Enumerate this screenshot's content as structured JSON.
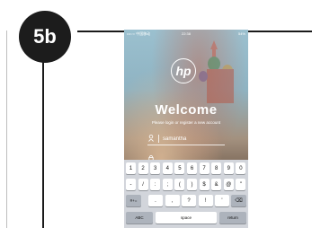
{
  "figure": {
    "label": "5b"
  },
  "status_bar": {
    "carrier": "•••○○ 中国移动",
    "wifi": "⌒",
    "time": "22:38",
    "battery": "54%"
  },
  "app": {
    "logo_text": "hp",
    "welcome": "Welcome",
    "subtitle": "Please login or register a new account",
    "username_value": "samantha",
    "user_icon": "user-icon",
    "lock_icon": "lock-icon"
  },
  "keyboard": {
    "row1": [
      "1",
      "2",
      "3",
      "4",
      "5",
      "6",
      "7",
      "8",
      "9",
      "0"
    ],
    "row2": [
      "-",
      "/",
      ":",
      ";",
      "(",
      ")",
      "$",
      "&",
      "@",
      "\""
    ],
    "row3": {
      "mode": "#+=",
      "keys": [
        ".",
        ",",
        "?",
        "!",
        "'"
      ],
      "backspace": "⌫"
    },
    "row4": {
      "abc": "ABC",
      "space": "space",
      "return": "return"
    }
  },
  "colors": {
    "frame": "#1a1a1a",
    "badge": "#1c1c1c",
    "keyboard_bg": "#d2d5db"
  }
}
